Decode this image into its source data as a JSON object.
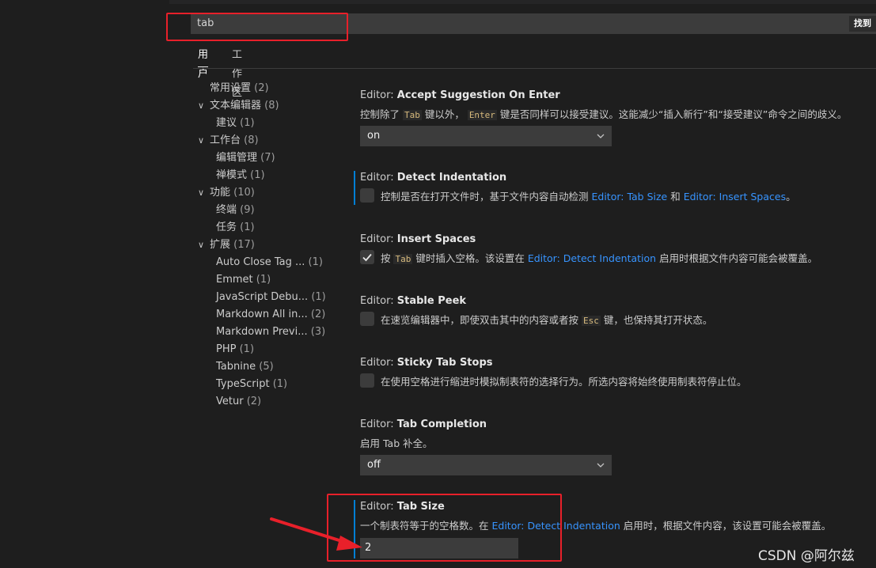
{
  "search": {
    "query": "tab",
    "find_button": "找到"
  },
  "tabs": [
    {
      "label": "用户"
    },
    {
      "label": "工作区"
    }
  ],
  "toc": [
    {
      "label": "常用设置",
      "count": "(2)"
    },
    {
      "label": "文本编辑器",
      "count": "(8)"
    },
    {
      "label": "建议",
      "count": "(1)"
    },
    {
      "label": "工作台",
      "count": "(8)"
    },
    {
      "label": "编辑管理",
      "count": "(7)"
    },
    {
      "label": "禅模式",
      "count": "(1)"
    },
    {
      "label": "功能",
      "count": "(10)"
    },
    {
      "label": "终端",
      "count": "(9)"
    },
    {
      "label": "任务",
      "count": "(1)"
    },
    {
      "label": "扩展",
      "count": "(17)"
    },
    {
      "label": "Auto Close Tag ...",
      "count": "(1)"
    },
    {
      "label": "Emmet",
      "count": "(1)"
    },
    {
      "label": "JavaScript Debu...",
      "count": "(1)"
    },
    {
      "label": "Markdown All in...",
      "count": "(2)"
    },
    {
      "label": "Markdown Previ...",
      "count": "(3)"
    },
    {
      "label": "PHP",
      "count": "(1)"
    },
    {
      "label": "Tabnine",
      "count": "(5)"
    },
    {
      "label": "TypeScript",
      "count": "(1)"
    },
    {
      "label": "Vetur",
      "count": "(2)"
    }
  ],
  "settings": {
    "accept_suggestion": {
      "category": "Editor: ",
      "name": "Accept Suggestion On Enter",
      "d1": "控制除了 ",
      "code1": "Tab",
      "d2": " 键以外， ",
      "code2": "Enter",
      "d3": " 键是否同样可以接受建议。这能减少“插入新行”和“接受建议”命令之间的歧义。",
      "value": "on"
    },
    "detect_indentation": {
      "category": "Editor: ",
      "name": "Detect Indentation",
      "d1": "控制是否在打开文件时，基于文件内容自动检测 ",
      "link1": "Editor: Tab Size",
      "d2": " 和 ",
      "link2": "Editor: Insert Spaces",
      "d3": "。",
      "checked": false
    },
    "insert_spaces": {
      "category": "Editor: ",
      "name": "Insert Spaces",
      "d1": "按 ",
      "code1": "Tab",
      "d2": " 键时插入空格。该设置在 ",
      "link1": "Editor: Detect Indentation",
      "d3": " 启用时根据文件内容可能会被覆盖。",
      "checked": true
    },
    "stable_peek": {
      "category": "Editor: ",
      "name": "Stable Peek",
      "d1": "在速览编辑器中，即使双击其中的内容或者按 ",
      "code1": "Esc",
      "d2": " 键，也保持其打开状态。",
      "checked": false
    },
    "sticky_tab_stops": {
      "category": "Editor: ",
      "name": "Sticky Tab Stops",
      "d1": "在使用空格进行缩进时模拟制表符的选择行为。所选内容将始终使用制表符停止位。",
      "checked": false
    },
    "tab_completion": {
      "category": "Editor: ",
      "name": "Tab Completion",
      "d1": "启用 Tab 补全。",
      "value": "off"
    },
    "tab_size": {
      "category": "Editor: ",
      "name": "Tab Size",
      "d1": "一个制表符等于的空格数。在 ",
      "link1": "Editor: Detect Indentation",
      "d2": " 启用时，根据文件内容，该设置可能会被覆盖。",
      "value": "2"
    }
  },
  "watermark": "CSDN @阿尔兹",
  "colors": {
    "background": "#1e1e1e",
    "accent": "#007fd4",
    "link": "#3794ff",
    "highlight": "#e8202a"
  }
}
